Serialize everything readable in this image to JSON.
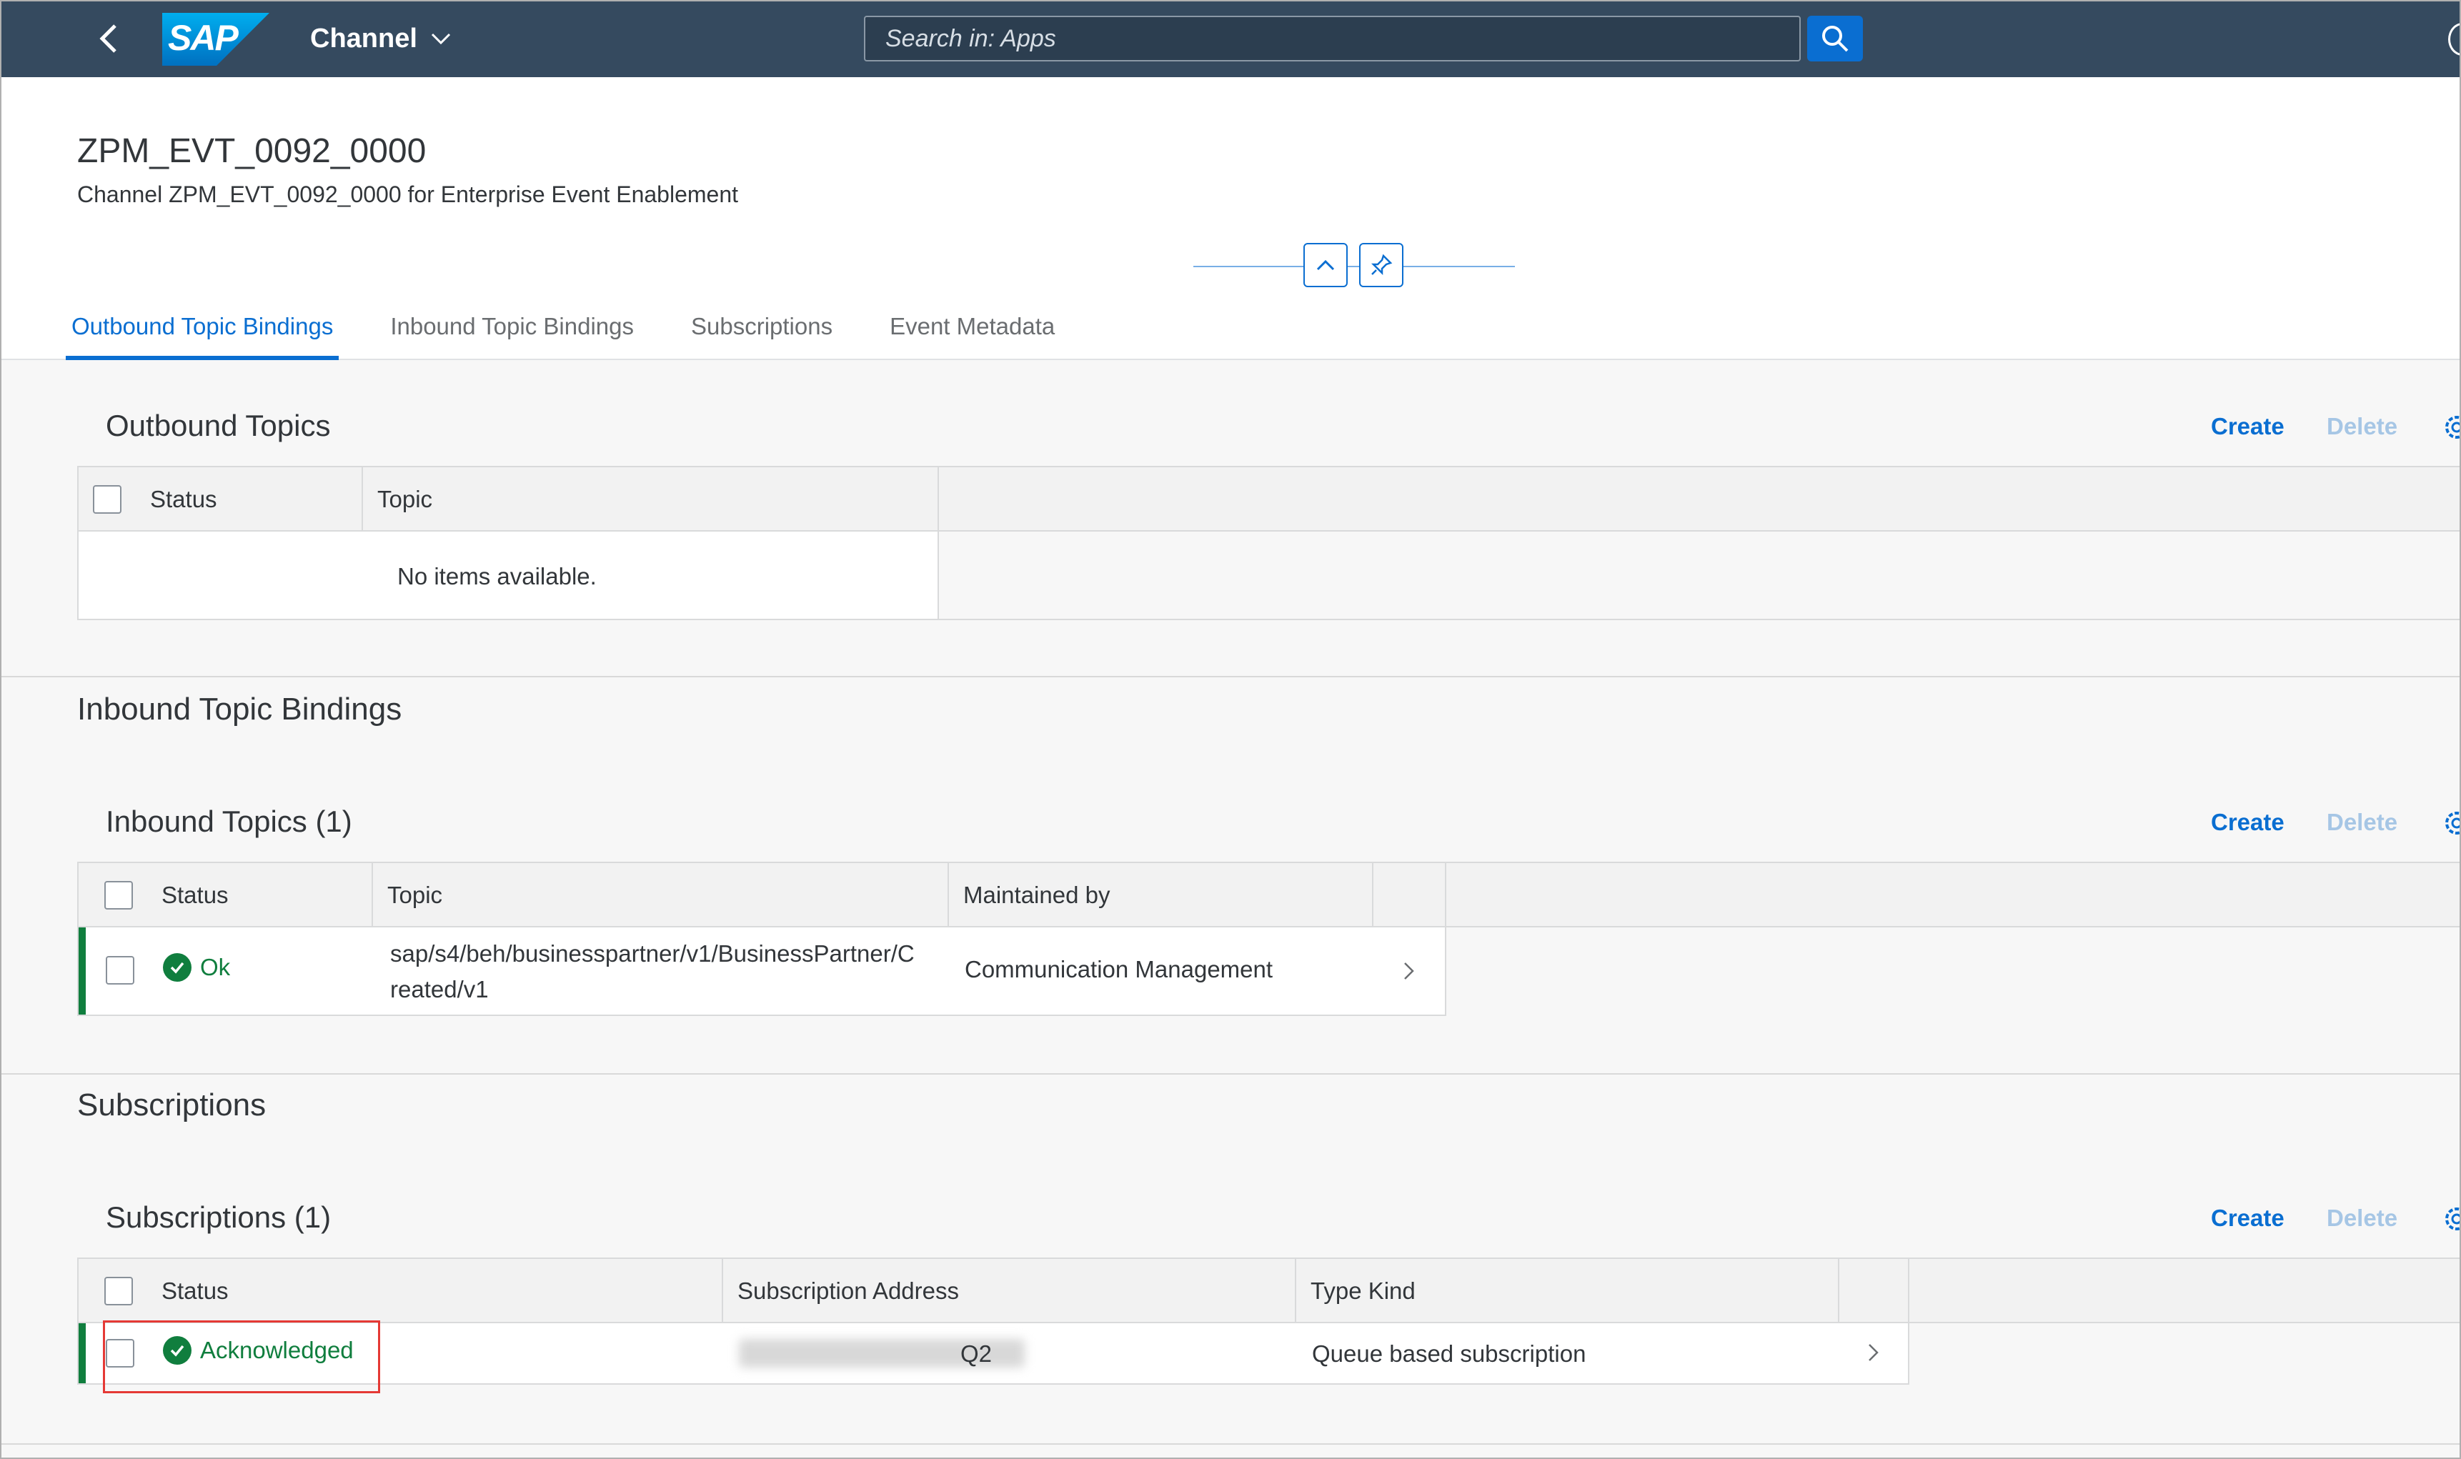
{
  "shell": {
    "logo_text": "SAP",
    "app_title": "Channel",
    "search_placeholder": "Search in: Apps"
  },
  "header": {
    "title": "ZPM_EVT_0092_0000",
    "subtitle": "Channel ZPM_EVT_0092_0000 for Enterprise Event Enablement"
  },
  "tabs": [
    {
      "label": "Outbound Topic Bindings",
      "active": true
    },
    {
      "label": "Inbound Topic Bindings",
      "active": false
    },
    {
      "label": "Subscriptions",
      "active": false
    },
    {
      "label": "Event Metadata",
      "active": false
    }
  ],
  "outbound": {
    "table_title": "Outbound Topics",
    "create_label": "Create",
    "delete_label": "Delete",
    "columns": [
      "Status",
      "Topic"
    ],
    "empty_text": "No items available."
  },
  "inbound": {
    "section_title": "Inbound Topic Bindings",
    "table_title": "Inbound Topics (1)",
    "create_label": "Create",
    "delete_label": "Delete",
    "columns": [
      "Status",
      "Topic",
      "Maintained by"
    ],
    "rows": [
      {
        "status": "Ok",
        "topic_line1": "sap/s4/beh/businesspartner/v1/BusinessPartner/C",
        "topic_line2": "reated/v1",
        "maintained_by": "Communication Management"
      }
    ]
  },
  "subscriptions": {
    "section_title": "Subscriptions",
    "table_title": "Subscriptions (1)",
    "create_label": "Create",
    "delete_label": "Delete",
    "columns": [
      "Status",
      "Subscription Address",
      "Type Kind"
    ],
    "rows": [
      {
        "status": "Acknowledged",
        "address": "Q2",
        "type_kind": "Queue based subscription"
      }
    ]
  },
  "colors": {
    "shell": "#354a5f",
    "accent": "#0a6ed1",
    "positive": "#107e3e",
    "highlight": "#e53935"
  },
  "icons": [
    "back-icon",
    "sap-logo",
    "chevron-down-icon",
    "search-icon",
    "collapse-up-icon",
    "pin-icon",
    "settings-gear-icon",
    "checkmark-circle-icon",
    "chevron-right-icon"
  ]
}
